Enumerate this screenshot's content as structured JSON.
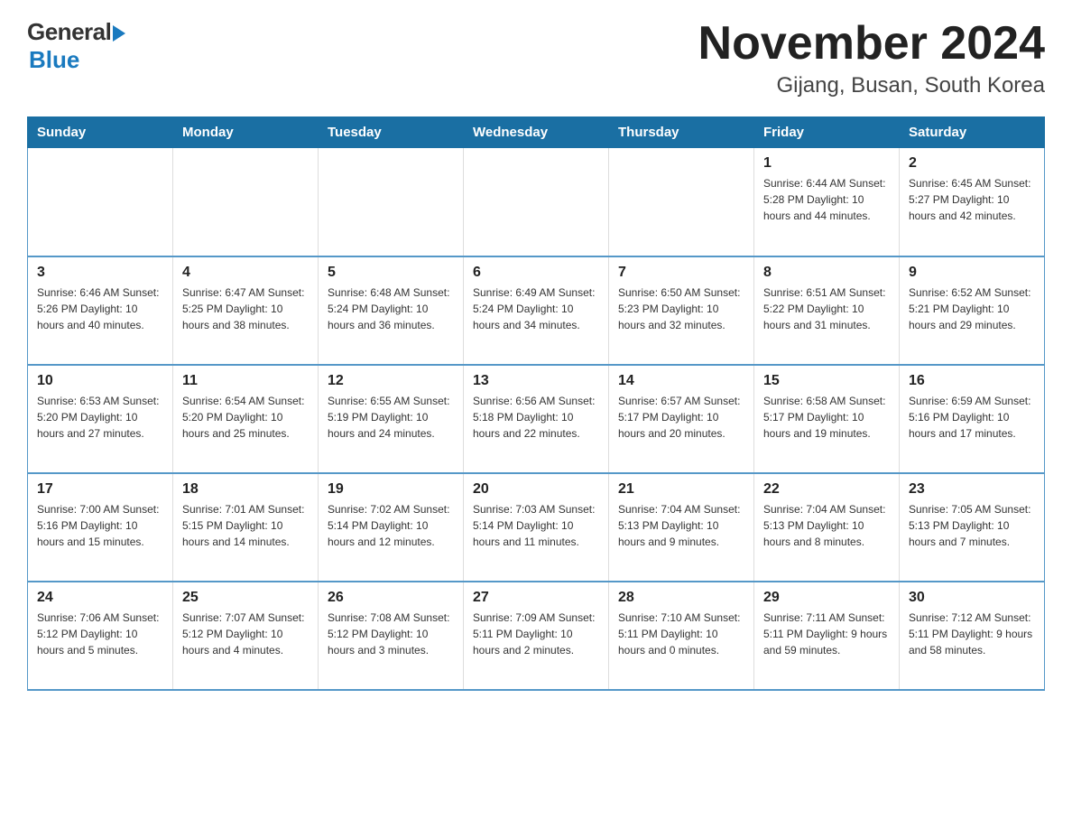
{
  "header": {
    "logo_general": "General",
    "logo_blue": "Blue",
    "month_title": "November 2024",
    "location": "Gijang, Busan, South Korea"
  },
  "days_of_week": [
    "Sunday",
    "Monday",
    "Tuesday",
    "Wednesday",
    "Thursday",
    "Friday",
    "Saturday"
  ],
  "weeks": [
    [
      {
        "day": "",
        "info": ""
      },
      {
        "day": "",
        "info": ""
      },
      {
        "day": "",
        "info": ""
      },
      {
        "day": "",
        "info": ""
      },
      {
        "day": "",
        "info": ""
      },
      {
        "day": "1",
        "info": "Sunrise: 6:44 AM\nSunset: 5:28 PM\nDaylight: 10 hours\nand 44 minutes."
      },
      {
        "day": "2",
        "info": "Sunrise: 6:45 AM\nSunset: 5:27 PM\nDaylight: 10 hours\nand 42 minutes."
      }
    ],
    [
      {
        "day": "3",
        "info": "Sunrise: 6:46 AM\nSunset: 5:26 PM\nDaylight: 10 hours\nand 40 minutes."
      },
      {
        "day": "4",
        "info": "Sunrise: 6:47 AM\nSunset: 5:25 PM\nDaylight: 10 hours\nand 38 minutes."
      },
      {
        "day": "5",
        "info": "Sunrise: 6:48 AM\nSunset: 5:24 PM\nDaylight: 10 hours\nand 36 minutes."
      },
      {
        "day": "6",
        "info": "Sunrise: 6:49 AM\nSunset: 5:24 PM\nDaylight: 10 hours\nand 34 minutes."
      },
      {
        "day": "7",
        "info": "Sunrise: 6:50 AM\nSunset: 5:23 PM\nDaylight: 10 hours\nand 32 minutes."
      },
      {
        "day": "8",
        "info": "Sunrise: 6:51 AM\nSunset: 5:22 PM\nDaylight: 10 hours\nand 31 minutes."
      },
      {
        "day": "9",
        "info": "Sunrise: 6:52 AM\nSunset: 5:21 PM\nDaylight: 10 hours\nand 29 minutes."
      }
    ],
    [
      {
        "day": "10",
        "info": "Sunrise: 6:53 AM\nSunset: 5:20 PM\nDaylight: 10 hours\nand 27 minutes."
      },
      {
        "day": "11",
        "info": "Sunrise: 6:54 AM\nSunset: 5:20 PM\nDaylight: 10 hours\nand 25 minutes."
      },
      {
        "day": "12",
        "info": "Sunrise: 6:55 AM\nSunset: 5:19 PM\nDaylight: 10 hours\nand 24 minutes."
      },
      {
        "day": "13",
        "info": "Sunrise: 6:56 AM\nSunset: 5:18 PM\nDaylight: 10 hours\nand 22 minutes."
      },
      {
        "day": "14",
        "info": "Sunrise: 6:57 AM\nSunset: 5:17 PM\nDaylight: 10 hours\nand 20 minutes."
      },
      {
        "day": "15",
        "info": "Sunrise: 6:58 AM\nSunset: 5:17 PM\nDaylight: 10 hours\nand 19 minutes."
      },
      {
        "day": "16",
        "info": "Sunrise: 6:59 AM\nSunset: 5:16 PM\nDaylight: 10 hours\nand 17 minutes."
      }
    ],
    [
      {
        "day": "17",
        "info": "Sunrise: 7:00 AM\nSunset: 5:16 PM\nDaylight: 10 hours\nand 15 minutes."
      },
      {
        "day": "18",
        "info": "Sunrise: 7:01 AM\nSunset: 5:15 PM\nDaylight: 10 hours\nand 14 minutes."
      },
      {
        "day": "19",
        "info": "Sunrise: 7:02 AM\nSunset: 5:14 PM\nDaylight: 10 hours\nand 12 minutes."
      },
      {
        "day": "20",
        "info": "Sunrise: 7:03 AM\nSunset: 5:14 PM\nDaylight: 10 hours\nand 11 minutes."
      },
      {
        "day": "21",
        "info": "Sunrise: 7:04 AM\nSunset: 5:13 PM\nDaylight: 10 hours\nand 9 minutes."
      },
      {
        "day": "22",
        "info": "Sunrise: 7:04 AM\nSunset: 5:13 PM\nDaylight: 10 hours\nand 8 minutes."
      },
      {
        "day": "23",
        "info": "Sunrise: 7:05 AM\nSunset: 5:13 PM\nDaylight: 10 hours\nand 7 minutes."
      }
    ],
    [
      {
        "day": "24",
        "info": "Sunrise: 7:06 AM\nSunset: 5:12 PM\nDaylight: 10 hours\nand 5 minutes."
      },
      {
        "day": "25",
        "info": "Sunrise: 7:07 AM\nSunset: 5:12 PM\nDaylight: 10 hours\nand 4 minutes."
      },
      {
        "day": "26",
        "info": "Sunrise: 7:08 AM\nSunset: 5:12 PM\nDaylight: 10 hours\nand 3 minutes."
      },
      {
        "day": "27",
        "info": "Sunrise: 7:09 AM\nSunset: 5:11 PM\nDaylight: 10 hours\nand 2 minutes."
      },
      {
        "day": "28",
        "info": "Sunrise: 7:10 AM\nSunset: 5:11 PM\nDaylight: 10 hours\nand 0 minutes."
      },
      {
        "day": "29",
        "info": "Sunrise: 7:11 AM\nSunset: 5:11 PM\nDaylight: 9 hours\nand 59 minutes."
      },
      {
        "day": "30",
        "info": "Sunrise: 7:12 AM\nSunset: 5:11 PM\nDaylight: 9 hours\nand 58 minutes."
      }
    ]
  ]
}
